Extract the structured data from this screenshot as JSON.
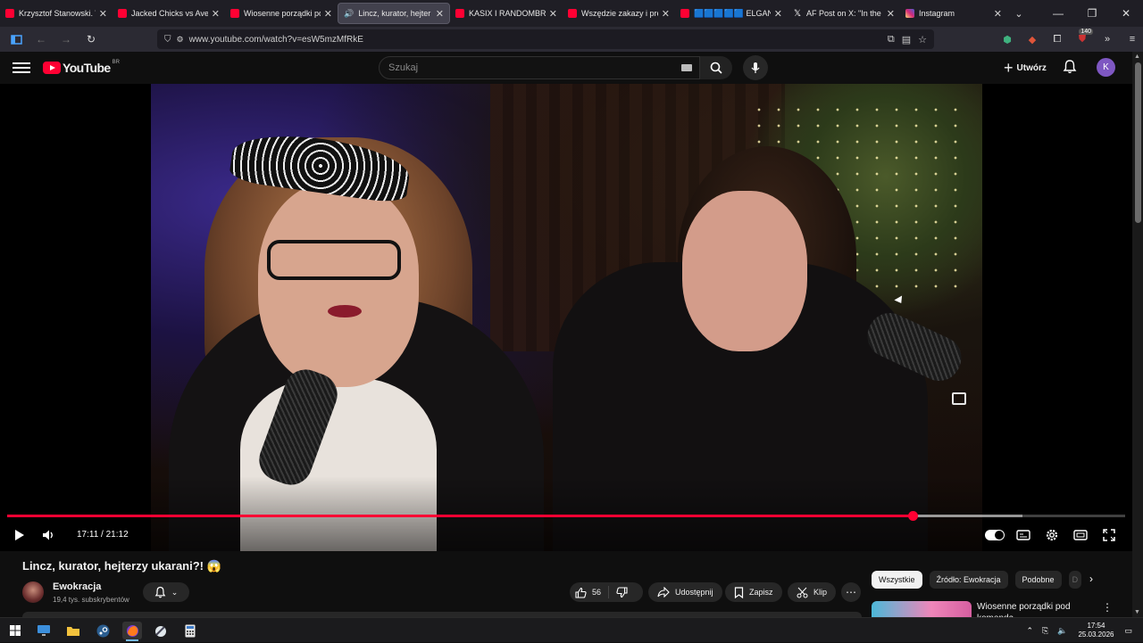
{
  "browser": {
    "tabs": [
      {
        "title": "Krzysztof Stanowski. W ja",
        "icon": "youtube-icon",
        "active": false
      },
      {
        "title": "Jacked Chicks vs Average",
        "icon": "youtube-icon",
        "active": false
      },
      {
        "title": "Wiosenne porządki pod k",
        "icon": "youtube-icon",
        "active": false
      },
      {
        "title": "Lincz, kurator, hejter",
        "icon": "youtube-icon",
        "active": true
      },
      {
        "title": "KASIX I RANDOMBRUCE",
        "icon": "youtube-icon",
        "active": false
      },
      {
        "title": "Wszędzie zakazy i preter",
        "icon": "youtube-icon",
        "active": false
      },
      {
        "title": "🟦🟦🟦🟦🟦 ELGANC",
        "icon": "youtube-icon",
        "active": false
      },
      {
        "title": "AF Post on X: \"In the first",
        "icon": "x-icon",
        "active": false
      },
      {
        "title": "Instagram",
        "icon": "instagram-icon",
        "active": false
      }
    ],
    "url": "www.youtube.com/watch?v=esW5mzMfRkE",
    "extension_badge": "140"
  },
  "youtube": {
    "logo_text": "YouTube",
    "region": "BR",
    "search_placeholder": "Szukaj",
    "create_label": "Utwórz",
    "avatar_letter": "K"
  },
  "player": {
    "current_time": "17:11",
    "duration": "21:12",
    "time_display": "17:11 / 21:12",
    "progress_fraction": 0.81,
    "buffered_fraction": 0.908,
    "autoplay": true
  },
  "video": {
    "title": "Lincz, kurator, hejterzy ukarani?! 😱",
    "channel": "Ewokracja",
    "subscribers": "19,4 tys. subskrybentów",
    "likes": "56",
    "share_label": "Udostępnij",
    "save_label": "Zapisz",
    "clip_label": "Klip"
  },
  "sidebar": {
    "chips": [
      "Wszystkie",
      "Źródło: Ewokracja",
      "Podobne",
      "D"
    ],
    "selected_chip": "Wszystkie",
    "recommendation_title": "Wiosenne porządki pod komenda"
  },
  "taskbar": {
    "time": "17:54",
    "date": "25.03.2026"
  },
  "colors": {
    "accent": "#ff0033",
    "background": "#0f0f0f",
    "chip_bg": "#272727"
  }
}
